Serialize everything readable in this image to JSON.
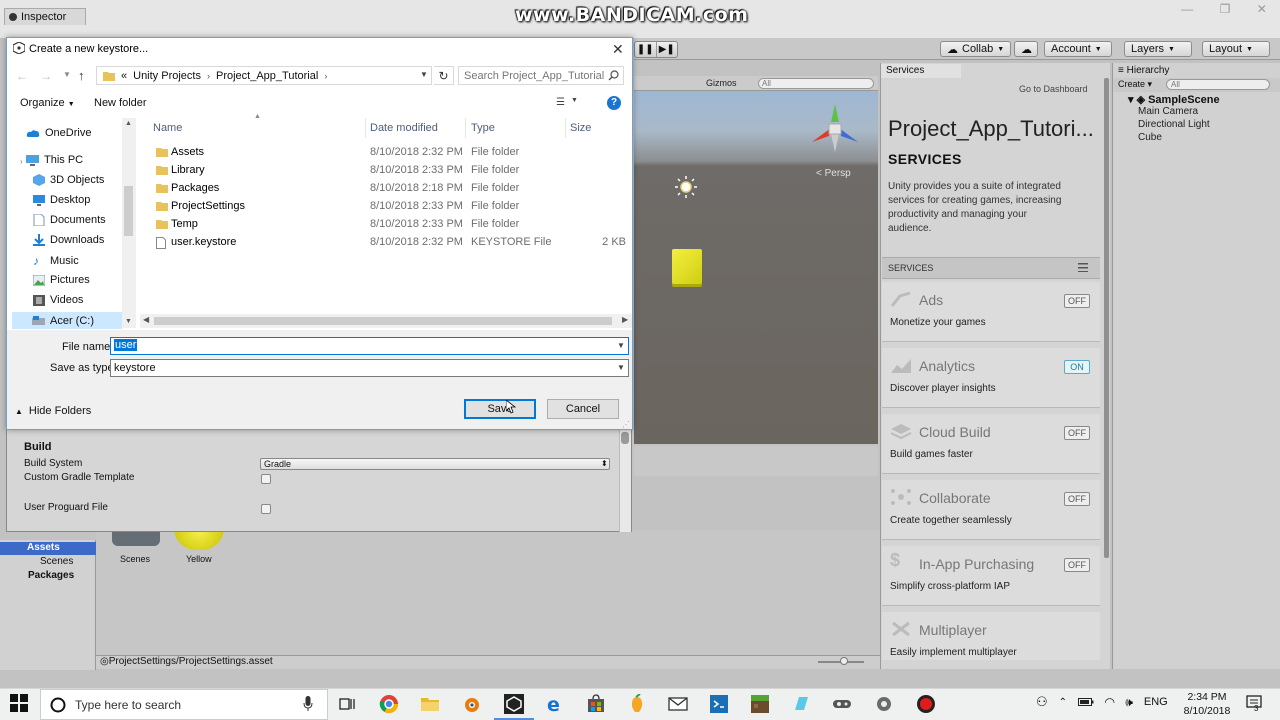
{
  "watermark": "www.BANDICAM.com",
  "editor": {
    "inspector_tab": "Inspector",
    "toolbar": {
      "collab": "Collab",
      "account": "Account",
      "layers": "Layers",
      "layout": "Layout"
    },
    "scene": {
      "gizmos": "Gizmos",
      "search": "All",
      "persp": "< Persp"
    },
    "services": {
      "tab": "Services",
      "go_dashboard": "Go to Dashboard",
      "project_title": "Project_App_Tutori...",
      "heading": "SERVICES",
      "description": "Unity provides you a suite of integrated services for creating games, increasing productivity and managing your audience.",
      "subbar": "SERVICES",
      "items": [
        {
          "name": "Ads",
          "desc": "Monetize your games",
          "status": "OFF"
        },
        {
          "name": "Analytics",
          "desc": "Discover player insights",
          "status": "ON"
        },
        {
          "name": "Cloud Build",
          "desc": "Build games faster",
          "status": "OFF"
        },
        {
          "name": "Collaborate",
          "desc": "Create together seamlessly",
          "status": "OFF"
        },
        {
          "name": "In-App Purchasing",
          "desc": "Simplify cross-platform IAP",
          "status": "OFF"
        },
        {
          "name": "Multiplayer",
          "desc": "Easily implement multiplayer",
          "status": ""
        }
      ]
    },
    "hierarchy": {
      "tab": "Hierarchy",
      "create": "Create",
      "search": "All",
      "scene": "SampleScene",
      "items": [
        "Main Camera",
        "Directional Light",
        "Cube"
      ]
    },
    "project": {
      "assets": "Assets",
      "scenes": "Scenes",
      "packages": "Packages",
      "thumb_scenes": "Scenes",
      "thumb_yellow": "Yellow",
      "status_path": "ProjectSettings/ProjectSettings.asset"
    },
    "inspector": {
      "build_heading": "Build",
      "build_system_label": "Build System",
      "build_system_value": "Gradle",
      "custom_gradle_label": "Custom Gradle Template",
      "user_proguard_label": "User Proguard File"
    }
  },
  "dialog": {
    "title": "Create a new keystore...",
    "breadcrumb": [
      "«",
      "Unity Projects",
      "Project_App_Tutorial"
    ],
    "search_placeholder": "Search Project_App_Tutorial",
    "organize": "Organize",
    "new_folder": "New folder",
    "help": "?",
    "nav": [
      {
        "label": "OneDrive",
        "icon": "cloud"
      },
      {
        "label": "This PC",
        "icon": "pc"
      },
      {
        "label": "3D Objects",
        "icon": "cube"
      },
      {
        "label": "Desktop",
        "icon": "desktop"
      },
      {
        "label": "Documents",
        "icon": "doc"
      },
      {
        "label": "Downloads",
        "icon": "down"
      },
      {
        "label": "Music",
        "icon": "music"
      },
      {
        "label": "Pictures",
        "icon": "pic"
      },
      {
        "label": "Videos",
        "icon": "video"
      },
      {
        "label": "Acer (C:)",
        "icon": "drive"
      }
    ],
    "columns": [
      "Name",
      "Date modified",
      "Type",
      "Size"
    ],
    "files": [
      {
        "name": "Assets",
        "date": "8/10/2018 2:32 PM",
        "type": "File folder",
        "size": ""
      },
      {
        "name": "Library",
        "date": "8/10/2018 2:33 PM",
        "type": "File folder",
        "size": ""
      },
      {
        "name": "Packages",
        "date": "8/10/2018 2:18 PM",
        "type": "File folder",
        "size": ""
      },
      {
        "name": "ProjectSettings",
        "date": "8/10/2018 2:33 PM",
        "type": "File folder",
        "size": ""
      },
      {
        "name": "Temp",
        "date": "8/10/2018 2:33 PM",
        "type": "File folder",
        "size": ""
      },
      {
        "name": "user.keystore",
        "date": "8/10/2018 2:32 PM",
        "type": "KEYSTORE File",
        "size": "2 KB"
      }
    ],
    "file_name_label": "File name:",
    "file_name_value": "user",
    "save_as_type_label": "Save as type:",
    "save_as_type_value": "keystore",
    "hide_folders": "Hide Folders",
    "save": "Save",
    "cancel": "Cancel"
  },
  "taskbar": {
    "search_placeholder": "Type here to search",
    "lang": "ENG",
    "time": "2:34 PM",
    "date": "8/10/2018",
    "notif_count": "3"
  }
}
